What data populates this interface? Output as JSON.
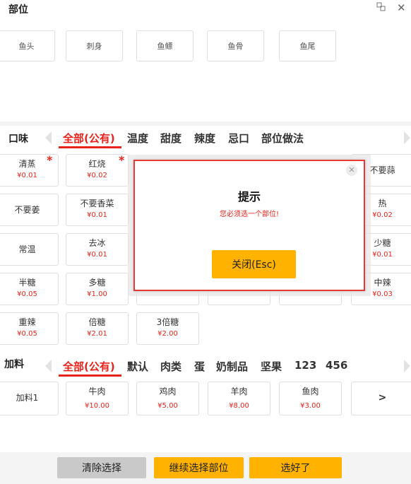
{
  "header": {
    "title": "部位"
  },
  "parts": [
    "鱼头",
    "刺身",
    "鱼鳔",
    "鱼骨",
    "鱼尾"
  ],
  "taste": {
    "label": "口味",
    "tabs": [
      "全部(公有)",
      "温度",
      "甜度",
      "辣度",
      "忌口",
      "部位做法"
    ],
    "items": [
      {
        "name": "清蒸",
        "price": "¥0.01"
      },
      {
        "name": "红烧",
        "price": "¥0.02"
      },
      {
        "name": "不要蒜",
        "price": ""
      },
      {
        "name": "不要姜",
        "price": ""
      },
      {
        "name": "不要香菜",
        "price": "¥0.01"
      },
      {
        "name": "热",
        "price": "¥0.02"
      },
      {
        "name": "常温",
        "price": ""
      },
      {
        "name": "去冰",
        "price": "¥0.01"
      },
      {
        "name": "少糖",
        "price": "¥0.01"
      },
      {
        "name": "半糖",
        "price": "¥0.05"
      },
      {
        "name": "多糖",
        "price": "¥1.00"
      },
      {
        "name": "中辣",
        "price": "¥0.03"
      },
      {
        "name": "重辣",
        "price": "¥0.05"
      },
      {
        "name": "倍糖",
        "price": "¥2.01"
      },
      {
        "name": "3倍糖",
        "price": "¥2.00"
      }
    ]
  },
  "addon": {
    "label": "加料",
    "tabs": [
      "全部(公有)",
      "默认",
      "肉类",
      "蛋",
      "奶制品",
      "坚果",
      "123",
      "456"
    ],
    "items": [
      {
        "name": "加料1",
        "price": ""
      },
      {
        "name": "牛肉",
        "price": "¥10.00"
      },
      {
        "name": "鸡肉",
        "price": "¥5.00"
      },
      {
        "name": "羊肉",
        "price": "¥8.00"
      },
      {
        "name": "鱼肉",
        "price": "¥3.00"
      }
    ],
    "more": ">"
  },
  "buttons": {
    "clear": "清除选择",
    "continue": "继续选择部位",
    "done": "选好了"
  },
  "dialog": {
    "title": "提示",
    "message": "您必须选一个部位!",
    "close_button": "关闭(Esc)"
  },
  "colors": {
    "accent_red": "#e8231b",
    "orange": "#ffb300",
    "gray_button": "#c9c9c9"
  }
}
